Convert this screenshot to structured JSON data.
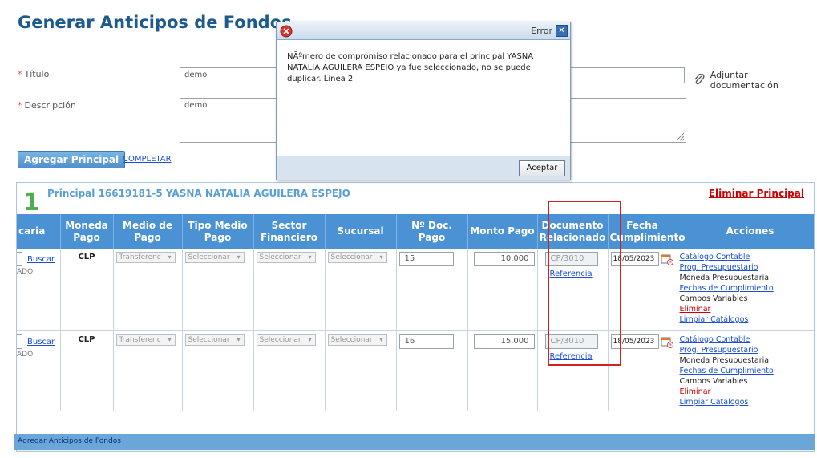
{
  "page": {
    "title": "Generar Anticipos de Fondos"
  },
  "form": {
    "titulo_label": "Título",
    "titulo_value": "demo",
    "descripcion_label": "Descripción",
    "descripcion_value": "demo",
    "attach_label": "Adjuntar documentación",
    "agregar_button": "Agregar Principal",
    "completar_link": "COMPLETAR"
  },
  "principal": {
    "number": "1",
    "title": "Principal 16619181-5 YASNA NATALIA AGUILERA ESPEJO",
    "eliminar_label": "Eliminar Principal"
  },
  "table": {
    "headers": [
      "caria",
      "Moneda Pago",
      "Medio de Pago",
      "Tipo Medio Pago",
      "Sector Financiero",
      "Sucursal",
      "Nº Doc. Pago",
      "Monto Pago",
      "Documento Relacionado",
      "Fecha Cumplimiento",
      "Acciones"
    ],
    "rows": [
      {
        "buscar": "Buscar",
        "ado": "ADO",
        "moneda": "CLP",
        "medio": "Transferenc",
        "tipo": "Seleccionar",
        "sector": "Seleccionar",
        "sucursal": "Seleccionar",
        "doc": "15",
        "monto": "10.000",
        "doc_rel": "CP/3010",
        "referencia": "Referencia",
        "fecha": "18/05/2023",
        "acciones": [
          "Catálogo Contable",
          "Prog. Presupuestario",
          "Moneda Presupuestaria",
          "Fechas de Cumplimiento",
          "Campos Variables",
          "Eliminar",
          "Limpiar Catálogos"
        ]
      },
      {
        "buscar": "Buscar",
        "ado": "ADO",
        "moneda": "CLP",
        "medio": "Transferenc",
        "tipo": "Seleccionar",
        "sector": "Seleccionar",
        "sucursal": "Seleccionar",
        "doc": "16",
        "monto": "15.000",
        "doc_rel": "CP/3010",
        "referencia": "Referencia",
        "fecha": "18/05/2023",
        "acciones": [
          "Catálogo Contable",
          "Prog. Presupuestario",
          "Moneda Presupuestaria",
          "Fechas de Cumplimiento",
          "Campos Variables",
          "Eliminar",
          "Limpiar Catálogos"
        ]
      }
    ]
  },
  "footer": {
    "link": "Agregar Anticipos de Fondos"
  },
  "dialog": {
    "title": "Error",
    "message": "NÃºmero de compromiso relacionado para el principal YASNA NATALIA AGUILERA ESPEJO ya fue seleccionado, no se puede duplicar. Linea 2",
    "ok_button": "Aceptar"
  },
  "colors": {
    "header_blue": "#4a92d3",
    "title_blue": "#1d5b8f",
    "link_blue": "#1a4fd1",
    "danger_red": "#cc0000",
    "highlight_red": "#d32020",
    "green_number": "#4caf50"
  }
}
